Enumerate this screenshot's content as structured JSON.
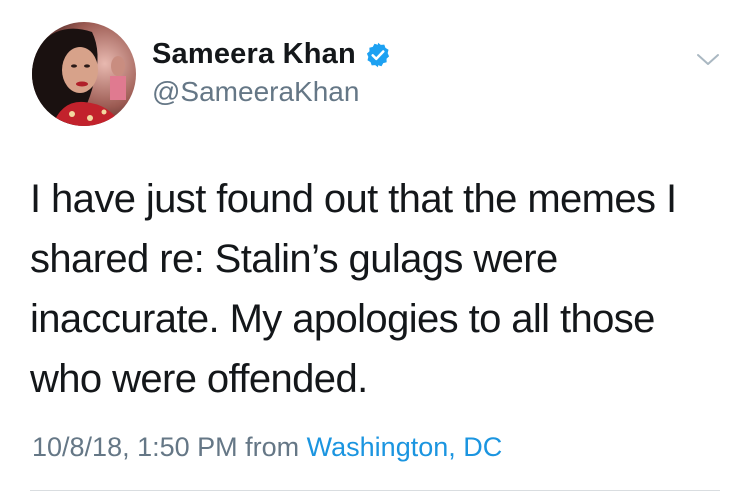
{
  "user": {
    "display_name": "Sameera Khan",
    "handle": "@SameeraKhan",
    "verified": true,
    "avatar_icon": "profile-photo",
    "verified_icon": "verified-badge-icon"
  },
  "tweet": {
    "text": "I have just found out that the memes I shared re: Stalin’s gulags were inaccurate. My apologies to all those who were offended.",
    "timestamp": "10/8/18, 1:50 PM",
    "from_label": "from",
    "location": "Washington, DC"
  },
  "controls": {
    "menu_icon": "chevron-down-icon"
  },
  "colors": {
    "text_primary": "#14171a",
    "text_secondary": "#657786",
    "link_blue": "#1b95e0",
    "verified_blue": "#1da1f2",
    "divider": "#d9dde0"
  }
}
